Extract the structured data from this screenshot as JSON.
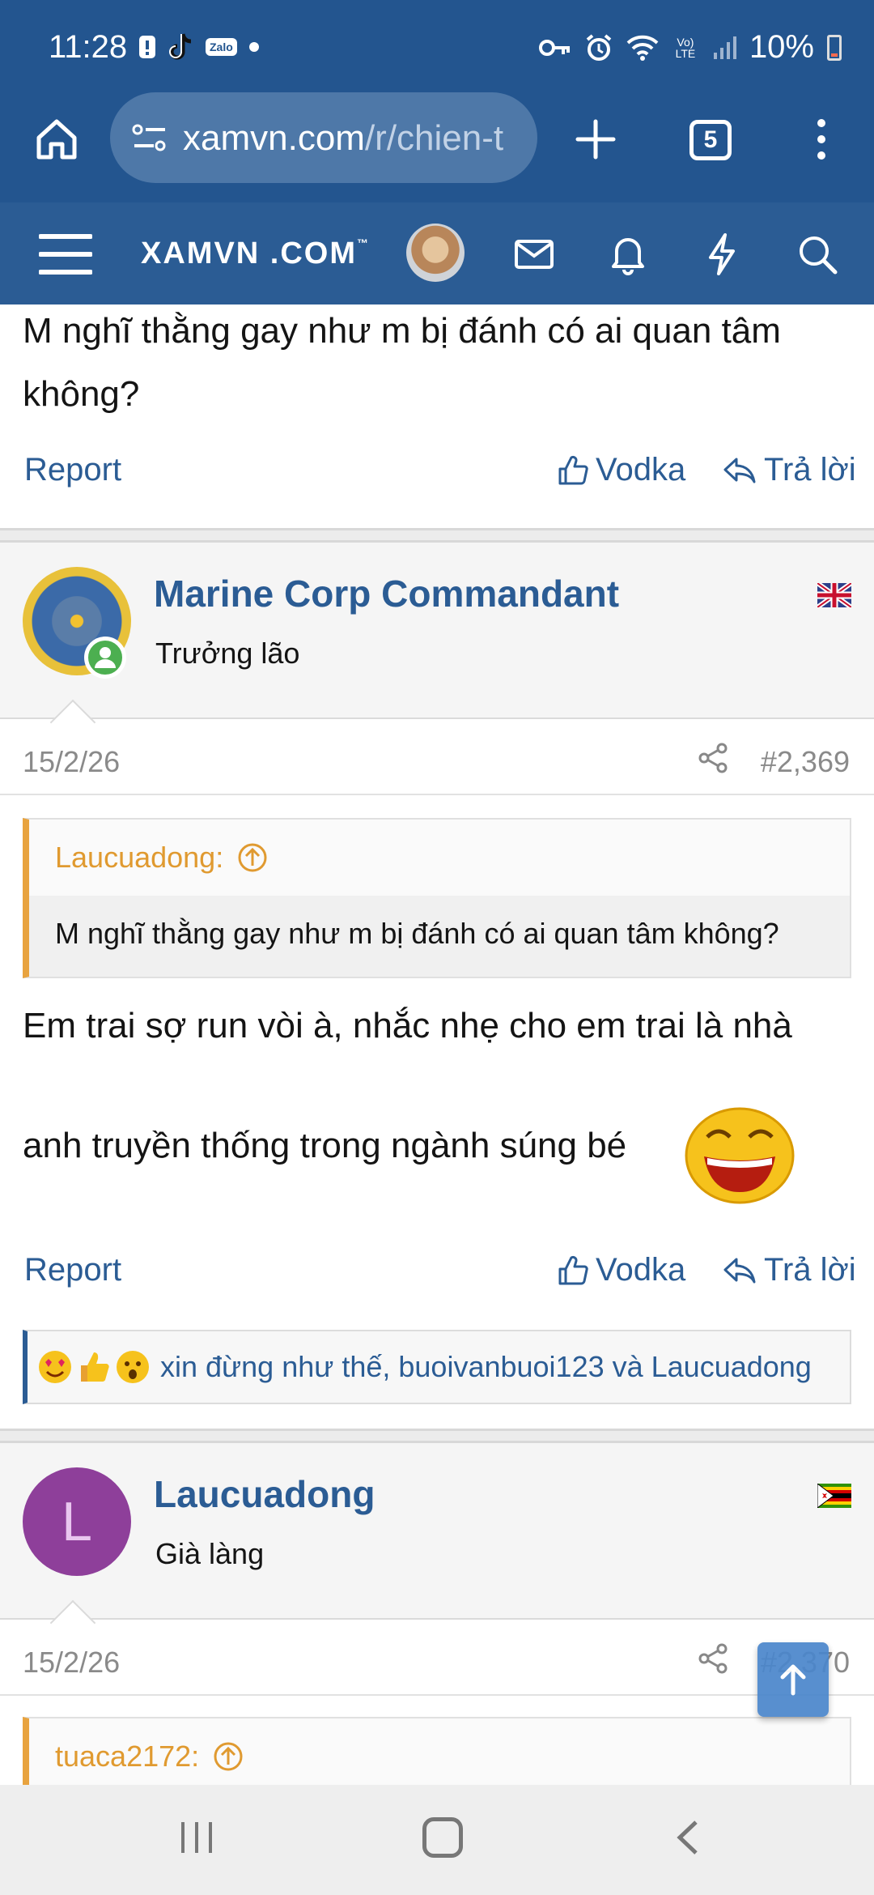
{
  "status_bar": {
    "time": "11:28",
    "battery": "10%",
    "network_label": "Vo) LTE",
    "icons": [
      "notification-icon",
      "tiktok-icon",
      "zalo-icon",
      "dot-icon",
      "key-icon",
      "alarm-icon",
      "wifi-icon",
      "signal-icon",
      "battery-icon"
    ]
  },
  "browser": {
    "url_host": "xamvn.com",
    "url_path": "/r/chien-t",
    "tab_count": "5"
  },
  "forum_nav": {
    "logo": "XAMVN .COM",
    "logo_mark": "™"
  },
  "posts": [
    {
      "tail_text": "M nghĩ thằng gay như m bị đánh có ai quan tâm không?",
      "actions": {
        "report": "Report",
        "vodka": "Vodka",
        "reply": "Trả lời"
      }
    },
    {
      "username": "Marine Corp Commandant",
      "user_title": "Trưởng lão",
      "date": "15/2/26",
      "post_number": "#2,369",
      "quote_author": "Laucuadong:",
      "quote_text": "M nghĩ thằng gay như m bị đánh có ai quan tâm không?",
      "body_line1": "Em trai sợ run vòi à, nhắc nhẹ cho em trai là nhà",
      "body_line2": "anh truyền thống trong ngành súng bé",
      "actions": {
        "report": "Report",
        "vodka": "Vodka",
        "reply": "Trả lời"
      },
      "reactions_text": "xin đừng như thế, buoivanbuoi123 và Laucuadong"
    },
    {
      "username": "Laucuadong",
      "avatar_letter": "L",
      "user_title": "Già làng",
      "date": "15/2/26",
      "post_number": "#2,370",
      "quote_author": "tuaca2172:"
    }
  ],
  "colors": {
    "header": "#23558f",
    "forum_nav": "#2b5c94",
    "link": "#2b5c94",
    "quote_accent": "#e8a33f",
    "avatar_purple": "#8e3f9a"
  }
}
